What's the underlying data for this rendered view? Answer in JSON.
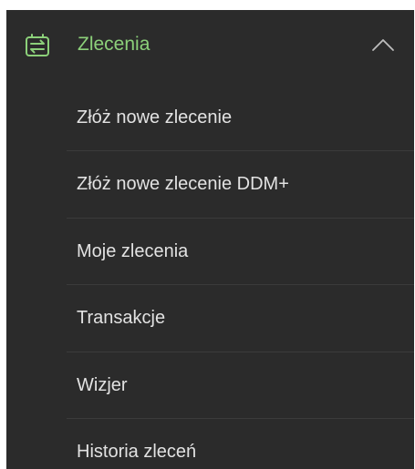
{
  "menu": {
    "section": {
      "title": "Zlecenia",
      "icon": "orders-exchange-icon",
      "expanded_icon": "chevron-up-icon",
      "accent_color": "#8cd07a"
    },
    "items": [
      {
        "label": "Złóż nowe zlecenie"
      },
      {
        "label": "Złóż nowe zlecenie DDM+"
      },
      {
        "label": "Moje zlecenia"
      },
      {
        "label": "Transakcje"
      },
      {
        "label": "Wizjer"
      },
      {
        "label": "Historia zleceń"
      }
    ],
    "colors": {
      "background": "#2b2b2b",
      "text": "#e2e2e2",
      "divider": "#3b3b3b"
    }
  }
}
